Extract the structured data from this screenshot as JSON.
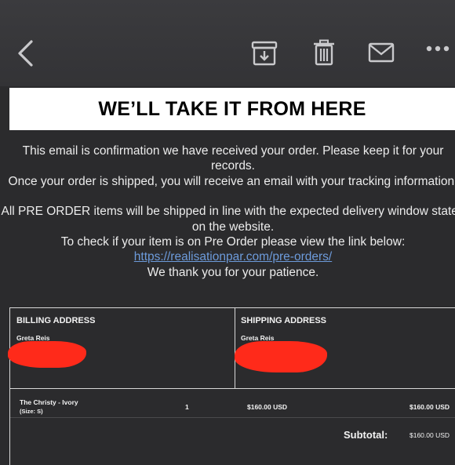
{
  "toolbar": {
    "icons": [
      "chevron-left-icon",
      "archive-icon",
      "trash-icon",
      "envelope-icon",
      "more-icon"
    ]
  },
  "banner": {
    "heading": "WE’LL TAKE IT FROM HERE"
  },
  "body": {
    "p1": "This email is confirmation we have received your order. Please keep it for your records.",
    "p2": "Once your order is shipped, you will receive an email with your tracking information.",
    "p3": "All PRE ORDER items will be shipped in line with the expected delivery window stated on the website.",
    "p4": "To check if your item is on Pre Order please view the link below:",
    "link": "https://realisationpar.com/pre-orders/",
    "p5": "We thank you for your patience."
  },
  "billing": {
    "title": "BILLING ADDRESS",
    "name": "Greta Reis"
  },
  "shipping": {
    "title": "SHIPPING ADDRESS",
    "name": "Greta Reis"
  },
  "line_item": {
    "product": "The Christy - Ivory",
    "size": "(Size: S)",
    "quantity": "1",
    "price": "$160.00 USD",
    "total": "$160.00 USD"
  },
  "summary": {
    "subtotal_label": "Subtotal:",
    "subtotal_value": "$160.00 USD"
  },
  "colors": {
    "background": "#2b2b2d",
    "toolbar": "#38383b",
    "link": "#6d9bdb",
    "redaction": "#ff2a1a"
  }
}
